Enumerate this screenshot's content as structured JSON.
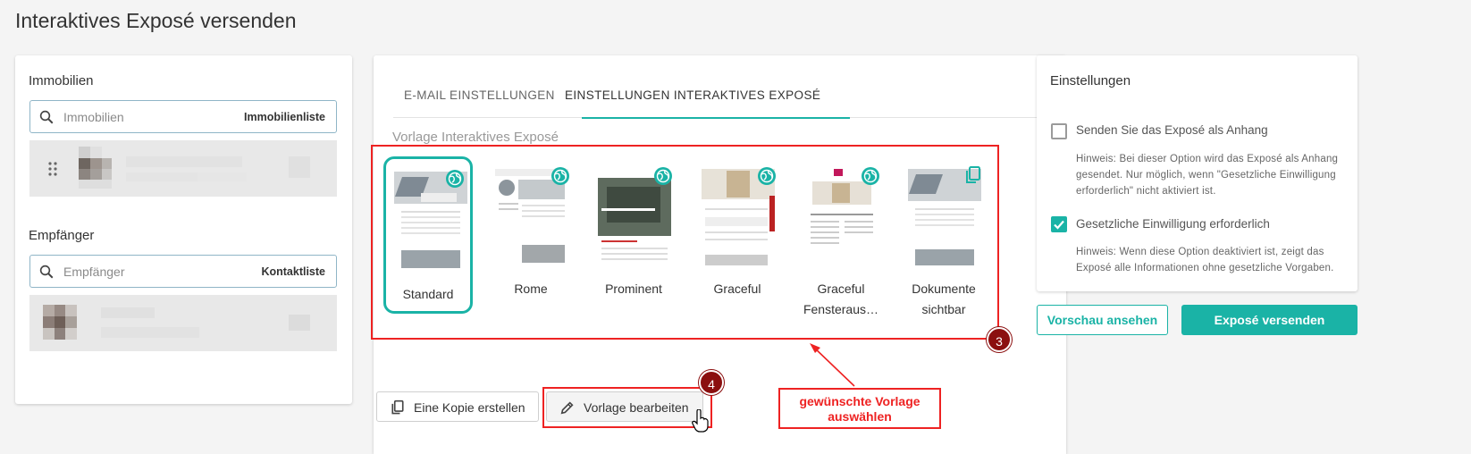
{
  "page": {
    "title": "Interaktives Exposé versenden"
  },
  "left": {
    "immobilien_label": "Immobilien",
    "immobilien_search": {
      "placeholder": "Immobilien",
      "link": "Immobilienliste"
    },
    "empfaenger_label": "Empfänger",
    "empfaenger_search": {
      "placeholder": "Empfänger",
      "link": "Kontaktliste"
    }
  },
  "tabs": [
    {
      "label": "E-MAIL EINSTELLUNGEN",
      "active": false
    },
    {
      "label": "EINSTELLUNGEN INTERAKTIVES EXPOSÉ",
      "active": true
    }
  ],
  "templates": {
    "label": "Vorlage Interaktives Exposé",
    "items": [
      {
        "name": "Standard",
        "selected": true,
        "icon": "globe-icon"
      },
      {
        "name": "Rome",
        "selected": false,
        "icon": "globe-icon"
      },
      {
        "name": "Prominent",
        "selected": false,
        "icon": "globe-icon"
      },
      {
        "name": "Graceful",
        "selected": false,
        "icon": "globe-icon"
      },
      {
        "name_line1": "Graceful",
        "name_line2": "Fensteraus…",
        "selected": false,
        "icon": "globe-icon"
      },
      {
        "name_line1": "Dokumente",
        "name_line2": "sichtbar",
        "selected": false,
        "icon": "copy-icon"
      }
    ]
  },
  "actions": {
    "copy": "Eine Kopie erstellen",
    "edit": "Vorlage bearbeiten"
  },
  "annotations": {
    "badge3": "3",
    "badge4": "4",
    "note_line1": "gewünschte Vorlage",
    "note_line2": "auswählen"
  },
  "settings": {
    "title": "Einstellungen",
    "option1": {
      "label": "Senden Sie das Exposé als Anhang",
      "checked": false,
      "hint_l1": "Hinweis: Bei dieser Option wird das Exposé als Anhang",
      "hint_l2": "gesendet. Nur möglich, wenn \"Gesetzliche Einwilligung",
      "hint_l3": "erforderlich\" nicht aktiviert ist."
    },
    "option2": {
      "label": "Gesetzliche Einwilligung erforderlich",
      "checked": true,
      "hint_l1": "Hinweis: Wenn diese Option deaktiviert ist, zeigt das",
      "hint_l2": "Exposé alle Informationen ohne gesetzliche Vorgaben."
    },
    "preview": "Vorschau ansehen",
    "send": "Exposé versenden"
  },
  "colors": {
    "accent": "#1ab3a6",
    "annotation": "#e22222",
    "badge": "#8b0f0f"
  }
}
